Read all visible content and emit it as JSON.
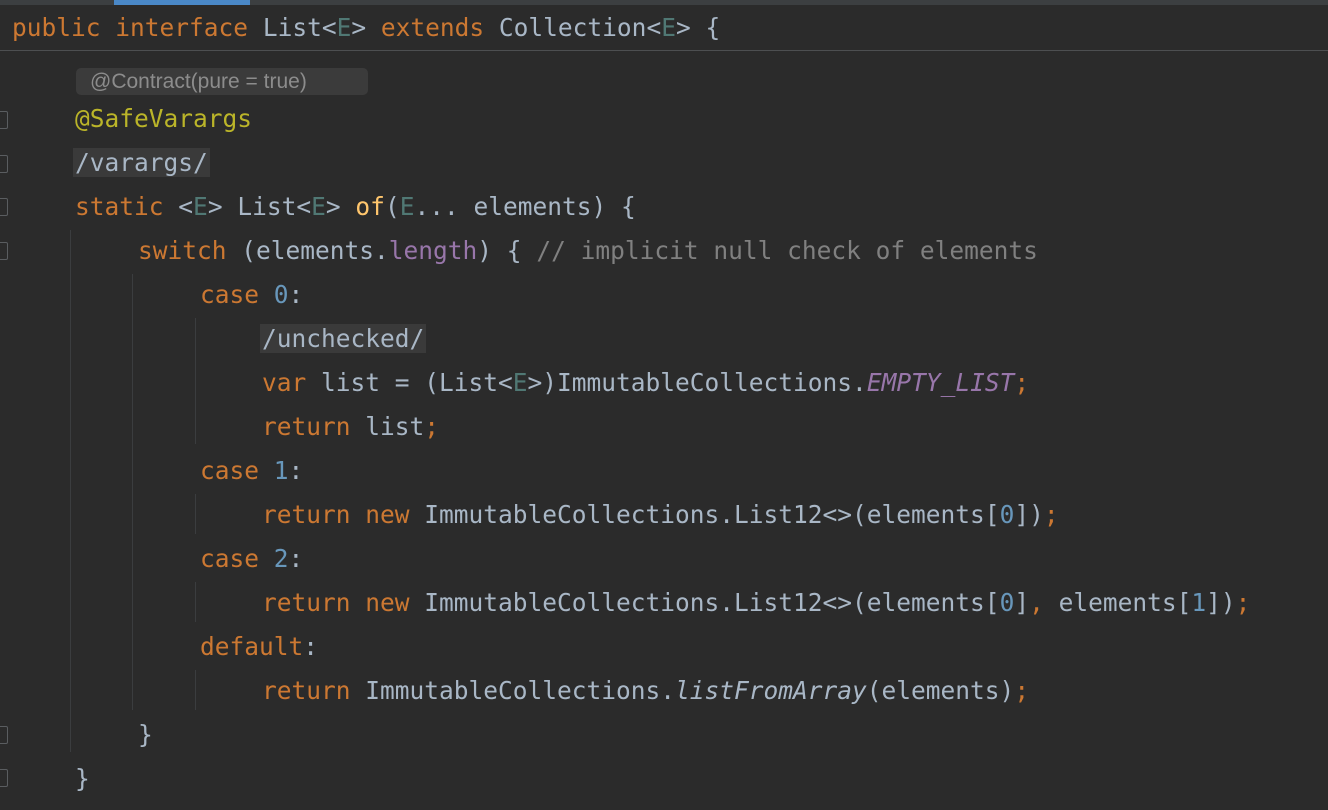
{
  "editor": {
    "header": {
      "kw_public": "public",
      "kw_interface": "interface",
      "type_list": "List",
      "lt": "<",
      "tparam": "E",
      "gt": ">",
      "kw_extends": "extends",
      "type_collection": "Collection",
      "brace": "{"
    },
    "inlay_hint": "@Contract(pure = true)",
    "annotation": "@SafeVarargs",
    "folded_varargs": "/varargs/",
    "folded_unchecked": "/unchecked/",
    "method_sig": {
      "kw_static": "static",
      "tparam_open": "<",
      "tparam": "E",
      "tparam_close": ">",
      "ret_type": "List",
      "method_name": "of",
      "param_type": "E",
      "param_rest": "... elements) {",
      "paren_open": "("
    },
    "switch_line": {
      "kw": "switch",
      "expr_open": " (elements.",
      "field": "length",
      "close": ") { ",
      "comment": "// implicit null check of elements"
    },
    "case0": {
      "kw": "case",
      "num": "0",
      "colon": ":"
    },
    "var_line": {
      "kw": "var",
      "text1": " list = (List<",
      "tparam": "E",
      "text2": ">)ImmutableCollections.",
      "static_field": "EMPTY_LIST",
      "semi": ";"
    },
    "return_list": {
      "kw": "return",
      "text": " list",
      "semi": ";"
    },
    "case1": {
      "kw": "case",
      "num": "1",
      "colon": ":"
    },
    "return1": {
      "kw": "return",
      "kw_new": "new",
      "text": " ImmutableCollections.List12<>(elements[",
      "num": "0",
      "close": "])",
      "semi": ";"
    },
    "case2": {
      "kw": "case",
      "num": "2",
      "colon": ":"
    },
    "return2": {
      "kw": "return",
      "kw_new": "new",
      "text": " ImmutableCollections.List12<>(elements[",
      "num1": "0",
      "mid": "]",
      "comma": ",",
      "text2": " elements[",
      "num2": "1",
      "close": "])",
      "semi": ";"
    },
    "default": {
      "kw": "default",
      "colon": ":"
    },
    "return_default": {
      "kw": "return",
      "text": " ImmutableCollections.",
      "method": "listFromArray",
      "args": "(elements)",
      "semi": ";"
    },
    "close_switch": "}",
    "close_method": "}"
  },
  "colors": {
    "background": "#2b2b2b",
    "keyword": "#cc7832",
    "text": "#a9b7c6",
    "number": "#6897bb",
    "annotation": "#bbb529",
    "comment": "#808080",
    "field": "#9876aa",
    "method_decl": "#ffc66d",
    "type_param": "#507874"
  }
}
